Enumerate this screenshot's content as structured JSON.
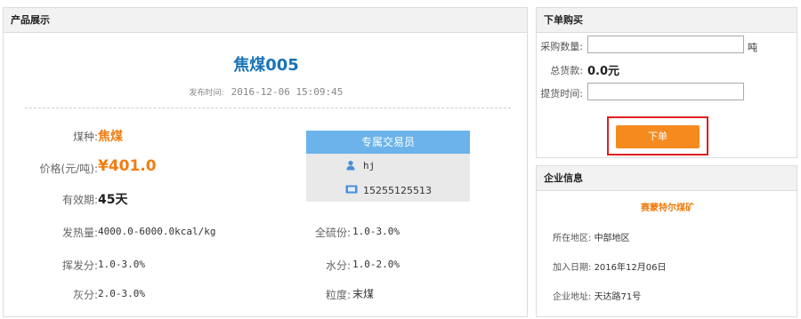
{
  "product": {
    "panel_title": "产品展示",
    "name": "焦煤005",
    "publish_label": "发布时间:",
    "publish_time": "2016-12-06 15:09:45",
    "coal_type_label": "煤种:",
    "coal_type": "焦煤",
    "price_label": "价格(元/吨):",
    "price": "¥401.0",
    "valid_label": "有效期:",
    "valid": "45天",
    "heat_label": "发热量:",
    "heat": "4000.0-6000.0kcal/kg",
    "sulfur_label": "全硫份:",
    "sulfur": "1.0-3.0%",
    "volatile_label": "挥发分:",
    "volatile": "1.0-3.0%",
    "moisture_label": "水分:",
    "moisture": "1.0-2.0%",
    "ash_label": "灰分:",
    "ash": "2.0-3.0%",
    "grain_label": "粒度:",
    "grain": "末煤"
  },
  "agent": {
    "title": "专属交易员",
    "name": "hj",
    "phone": "15255125513",
    "color_head": "#6bb3ea"
  },
  "order": {
    "panel_title": "下单购买",
    "qty_label": "采购数量:",
    "qty_value": "",
    "qty_unit": "吨",
    "total_label": "总货款:",
    "total_value": "0.0元",
    "pickup_label": "提货时间:",
    "pickup_value": "",
    "submit_label": "下单",
    "accent": "#f58a1f"
  },
  "company": {
    "panel_title": "企业信息",
    "name": "赛蒙特尔煤矿",
    "region_label": "所在地区:",
    "region": "中部地区",
    "join_label": "加入日期:",
    "join_date": "2016年12月06日",
    "address_label": "企业地址:",
    "address": "天达路71号"
  }
}
